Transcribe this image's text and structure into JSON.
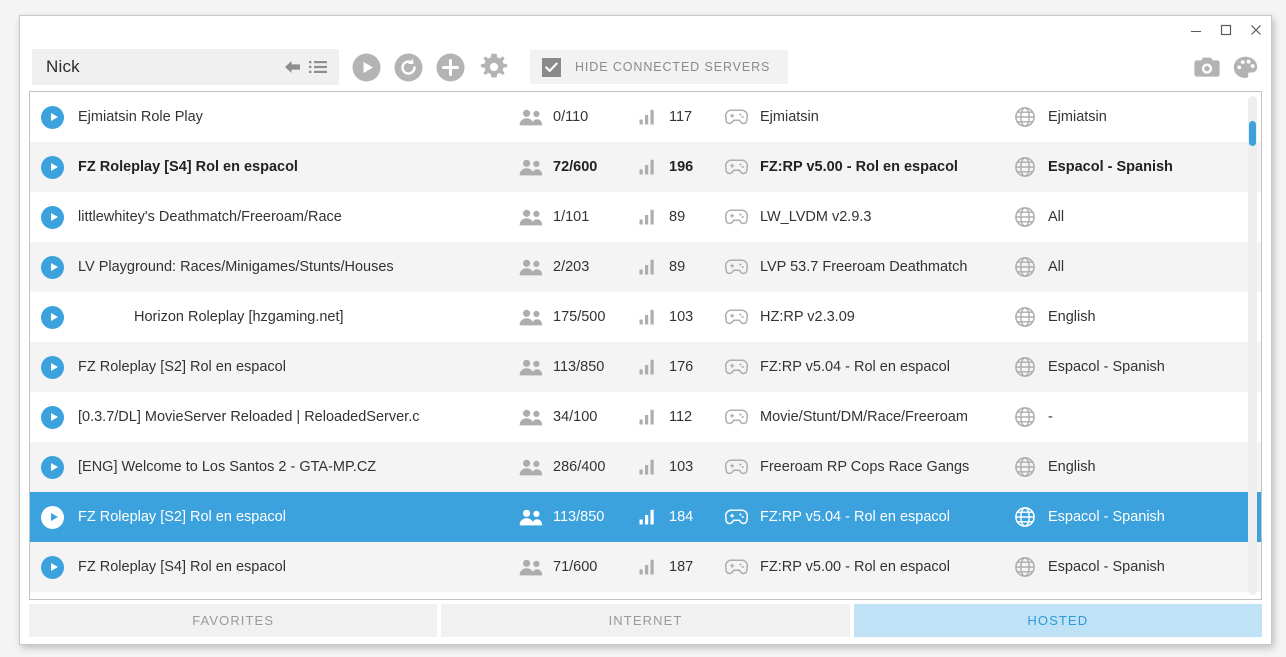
{
  "window": {
    "controls": [
      {
        "name": "minimize-button",
        "glyph": "minimize"
      },
      {
        "name": "maximize-button",
        "glyph": "maximize"
      },
      {
        "name": "close-button",
        "glyph": "close"
      }
    ]
  },
  "toolbar": {
    "nickname_value": "Nick",
    "nickname_placeholder": "Nick",
    "back_icon": "back-arrow-icon",
    "list_icon": "list-icon",
    "play_icon": "play-icon",
    "refresh_icon": "refresh-icon",
    "add_icon": "add-icon",
    "settings_icon": "gear-icon",
    "hide_connected_label": "HIDE CONNECTED SERVERS",
    "hide_connected_checked": true,
    "screenshot_icon": "camera-icon",
    "theme_icon": "palette-icon"
  },
  "colors": {
    "accent": "#3ba2dd",
    "tab_active_bg": "#bfe2f7",
    "tab_active_text": "#2e9ad6",
    "row_alt_bg": "#f4f4f4",
    "icon_grey": "#adadad"
  },
  "scrollbar": {
    "thumb_top_pct": 5,
    "thumb_height_pct": 5
  },
  "servers": [
    {
      "name": "Ejmiatsin Role Play",
      "players": "0/110",
      "ping": "117",
      "mode": "Ejmiatsin",
      "language": "Ejmiatsin",
      "bold": false,
      "selected": false,
      "indented": false
    },
    {
      "name": "FZ Roleplay [S4] Rol en espacol",
      "players": "72/600",
      "ping": "196",
      "mode": "FZ:RP v5.00 - Rol en espacol",
      "language": "Espacol - Spanish",
      "bold": true,
      "selected": false,
      "indented": false
    },
    {
      "name": "littlewhitey's Deathmatch/Freeroam/Race",
      "players": "1/101",
      "ping": "89",
      "mode": "LW_LVDM v2.9.3",
      "language": "All",
      "bold": false,
      "selected": false,
      "indented": false
    },
    {
      "name": "LV Playground: Races/Minigames/Stunts/Houses",
      "players": "2/203",
      "ping": "89",
      "mode": "LVP 53.7 Freeroam Deathmatch",
      "language": "All",
      "bold": false,
      "selected": false,
      "indented": false
    },
    {
      "name": "Horizon Roleplay [hzgaming.net]",
      "players": "175/500",
      "ping": "103",
      "mode": "HZ:RP v2.3.09",
      "language": "English",
      "bold": false,
      "selected": false,
      "indented": true
    },
    {
      "name": "FZ Roleplay [S2] Rol en espacol",
      "players": "113/850",
      "ping": "176",
      "mode": "FZ:RP v5.04 - Rol en espacol",
      "language": "Espacol - Spanish",
      "bold": false,
      "selected": false,
      "indented": false
    },
    {
      "name": "[0.3.7/DL] MovieServer Reloaded | ReloadedServer.c",
      "players": "34/100",
      "ping": "112",
      "mode": "Movie/Stunt/DM/Race/Freeroam",
      "language": "-",
      "bold": false,
      "selected": false,
      "indented": false
    },
    {
      "name": "[ENG] Welcome to Los Santos 2 - GTA-MP.CZ",
      "players": "286/400",
      "ping": "103",
      "mode": "Freeroam RP Cops Race Gangs",
      "language": "English",
      "bold": false,
      "selected": false,
      "indented": false
    },
    {
      "name": "FZ Roleplay [S2] Rol en espacol",
      "players": "113/850",
      "ping": "184",
      "mode": "FZ:RP v5.04 - Rol en espacol",
      "language": "Espacol - Spanish",
      "bold": false,
      "selected": true,
      "indented": false
    },
    {
      "name": "FZ Roleplay [S4] Rol en espacol",
      "players": "71/600",
      "ping": "187",
      "mode": "FZ:RP v5.00 - Rol en espacol",
      "language": "Espacol - Spanish",
      "bold": false,
      "selected": false,
      "indented": false
    }
  ],
  "tabs": [
    {
      "label": "FAVORITES",
      "active": false,
      "name": "tab-favorites"
    },
    {
      "label": "INTERNET",
      "active": false,
      "name": "tab-internet"
    },
    {
      "label": "HOSTED",
      "active": true,
      "name": "tab-hosted"
    }
  ]
}
